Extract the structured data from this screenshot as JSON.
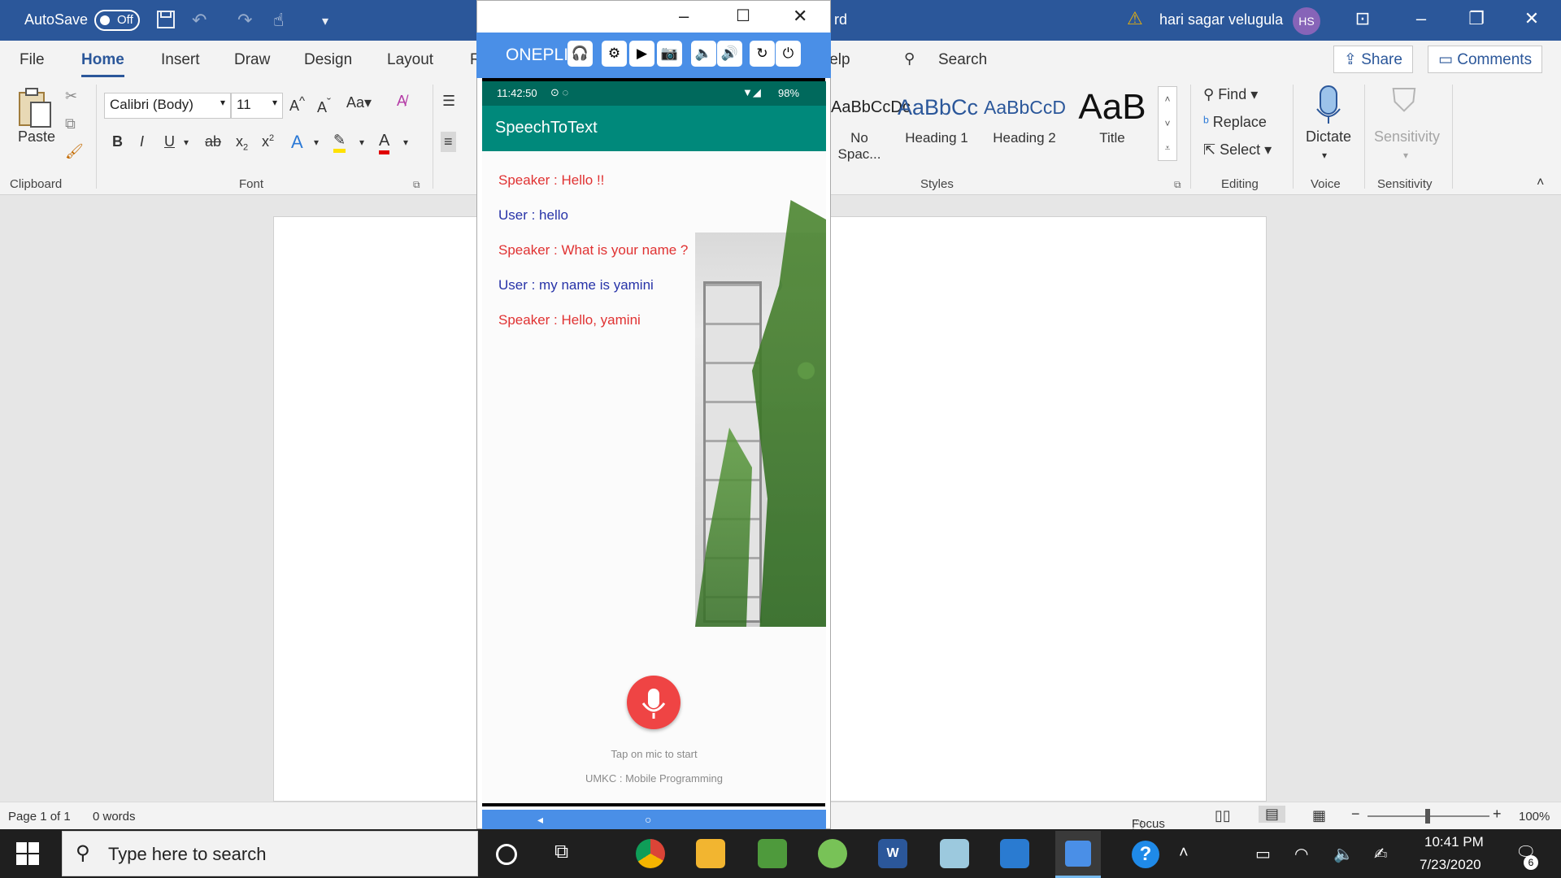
{
  "word": {
    "autosave_label": "AutoSave",
    "autosave_state": "Off",
    "title_fragment": "rd",
    "user_name": "hari sagar velugula",
    "user_initials": "HS",
    "tabs": [
      "File",
      "Home",
      "Insert",
      "Draw",
      "Design",
      "Layout",
      "R",
      "lelp"
    ],
    "search_label": "Search",
    "share_label": "Share",
    "comments_label": "Comments",
    "clipboard": {
      "paste": "Paste",
      "group": "Clipboard"
    },
    "font": {
      "name": "Calibri (Body)",
      "size": "11",
      "group": "Font",
      "case_label": "Aa",
      "bold": "B",
      "italic": "I",
      "underline": "U",
      "strike": "ab",
      "sub": "x",
      "sup": "x"
    },
    "styles": {
      "items": [
        {
          "sample": "AaBbCcDc",
          "name": "No Spac..."
        },
        {
          "sample": "AaBbCc",
          "name": "Heading 1"
        },
        {
          "sample": "AaBbCcD",
          "name": "Heading 2"
        },
        {
          "sample": "AaB",
          "name": "Title"
        }
      ],
      "group": "Styles"
    },
    "editing": {
      "find": "Find",
      "replace": "Replace",
      "select": "Select",
      "group": "Editing"
    },
    "voice": {
      "dictate": "Dictate",
      "group": "Voice"
    },
    "sensitivity": {
      "label": "Sensitivity",
      "group": "Sensitivity"
    },
    "status": {
      "page": "Page 1 of 1",
      "words": "0 words",
      "focus": "Focus",
      "zoom": "100%"
    }
  },
  "emulator": {
    "device_name": "ONEPLI",
    "phone_time": "11:42:50",
    "battery": "98%",
    "app_title": "SpeechToText",
    "messages": [
      {
        "role": "speaker",
        "text": "Speaker : Hello !!"
      },
      {
        "role": "user",
        "text": "User : hello"
      },
      {
        "role": "speaker",
        "text": "Speaker : What is your name ?"
      },
      {
        "role": "user",
        "text": "User : my name is yamini"
      },
      {
        "role": "speaker",
        "text": "Speaker : Hello, yamini"
      }
    ],
    "hint": "Tap on mic to start",
    "footer": "UMKC : Mobile Programming"
  },
  "taskbar": {
    "search_placeholder": "Type here to search",
    "time": "10:41 PM",
    "date": "7/23/2020",
    "notification_count": "6"
  },
  "colors": {
    "word_blue": "#2b579a",
    "emulator_blue": "#4a8fe7",
    "app_teal": "#00897b",
    "speaker_red": "#e03232",
    "user_blue": "#2733a8",
    "mic_red": "#ef4444"
  }
}
